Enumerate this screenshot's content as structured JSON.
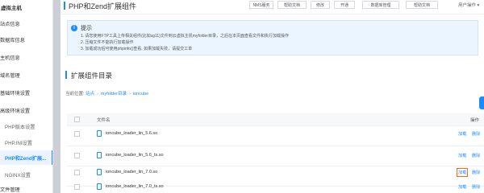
{
  "sidebar": {
    "header": "虚拟主机",
    "items": [
      {
        "label": "站点信息",
        "type": "normal"
      },
      {
        "label": "数据库信息",
        "type": "normal"
      },
      {
        "label": "主机信息",
        "type": "normal"
      },
      {
        "label": "域名管理",
        "type": "normal"
      },
      {
        "label": "基础环境设置",
        "type": "normal"
      },
      {
        "label": "高级环境设置",
        "type": "normal"
      },
      {
        "label": "PHP版本设置",
        "type": "sub"
      },
      {
        "label": "PHP.INI设置",
        "type": "sub"
      },
      {
        "label": "PHP和Zend扩展...",
        "type": "active"
      },
      {
        "label": "NGINX设置",
        "type": "sub"
      },
      {
        "label": "文件管理",
        "type": "normal"
      }
    ]
  },
  "page": {
    "title": "PHP和Zend扩展组件",
    "toolbar": [
      "NMS服务",
      "帮助文档",
      "修改",
      "开通",
      "数据库管理",
      "帮助文档"
    ],
    "user": "用户操作 ▾"
  },
  "notice": {
    "title": "提示",
    "lines": [
      "1. 请您使用FTP工具上传相关组件(比如sg11)文件到云虚拟主机myfolder目录，之后在本页面查看文件和执行加载操作",
      "2. 压缩文件不能执行加载操作",
      "3. 加载成功后可使用phpinfo()查看, 如果加载失败，请提交工单"
    ]
  },
  "section": {
    "title": "扩展组件目录",
    "breadcrumb": {
      "prefix": "当前位置:",
      "items": [
        "站点",
        "myfolder目录",
        "ioncube"
      ]
    }
  },
  "table": {
    "headers": {
      "name": "文件名",
      "ops": "操作"
    },
    "load_label": "加载",
    "delete_label": "删除",
    "rows": [
      {
        "name": "ioncube_loader_lin_5.6.so"
      },
      {
        "name": "ioncube_loader_lin_5.6_ts.so"
      },
      {
        "name": "ioncube_loader_lin_7.0.so"
      },
      {
        "name": "ioncube_loader_lin_7.0_ts.so"
      }
    ]
  },
  "colors": {
    "accent": "#1a8cff",
    "highlight": "#ff6a00"
  },
  "icons": [
    "info-icon",
    "file-icon",
    "checkbox-icon"
  ]
}
